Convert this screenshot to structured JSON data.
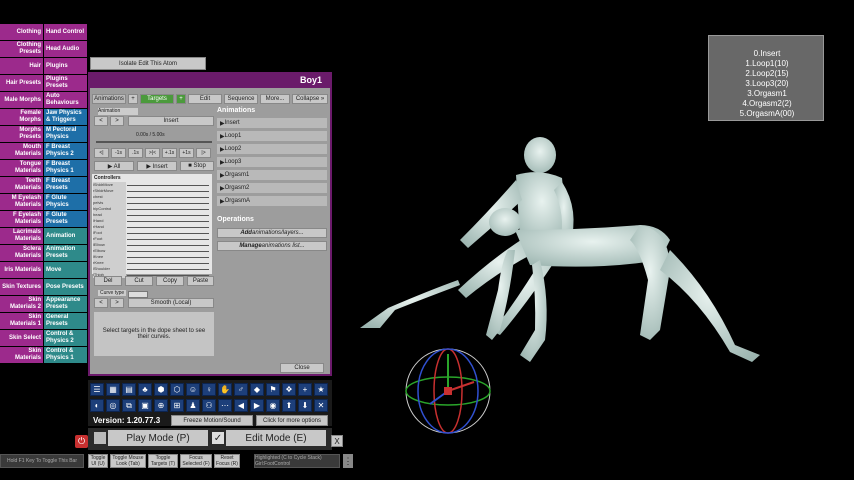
{
  "tabs": {
    "left": [
      "Clothing",
      "Clothing Presets",
      "Hair",
      "Hair Presets",
      "Male Morphs",
      "Female Morphs",
      "Morphs Presets",
      "Mouth Materials",
      "Tongue Materials",
      "Teeth Materials",
      "M Eyelash Materials",
      "F Eyelash Materials",
      "Lacrimals Materials",
      "Sclera Materials",
      "Iris Materials",
      "Skin Textures",
      "Skin Materials 2",
      "Skin Materials 1",
      "Skin Select",
      "Skin Materials"
    ],
    "right": [
      "Hand Control",
      "Head Audio",
      "Plugins",
      "Plugins Presets",
      "Auto Behaviours",
      "Jaw Physics & Triggers",
      "M Pectoral Physics",
      "F Breast Physics 2",
      "F Breast Physics 1",
      "F Breast Presets",
      "F Glute Physics",
      "F Glute Presets",
      "Animation",
      "Animation Presets",
      "Move",
      "Pose Presets",
      "Appearance Presets",
      "General Presets",
      "Control & Physics 2",
      "Control & Physics 1"
    ]
  },
  "isolate_button": "Isolate Edit This Atom",
  "panel": {
    "title": "Boy1",
    "top_tabs": [
      "Animations",
      "+",
      "Targets",
      "+",
      "Edit",
      "Sequence",
      "More...",
      "Collapse »"
    ],
    "animation_label": "Animation",
    "nav_prev": "<",
    "nav_next": ">",
    "insert": "Insert",
    "time_display": "0.00s / 5.00s",
    "transport": [
      "<|",
      "-1s",
      ".1s",
      ">|<",
      "+.1s",
      "+1s",
      "|>"
    ],
    "play_all": "▶ All",
    "play_insert": "▶ Insert",
    "stop": "■ Stop",
    "controllers_label": "Controllers",
    "controllers": [
      "lShldrMove",
      "rShldrMove",
      "chest",
      "pelvis",
      "hipControl",
      "head",
      "lHand",
      "rHand",
      "lFoot",
      "rFoot",
      "lElbow",
      "rElbow",
      "lKnee",
      "rKnee",
      "lShoulder",
      "lThigh"
    ],
    "edit_buttons": [
      "Del",
      "Cut",
      "Copy",
      "Paste"
    ],
    "curve_type_label": "Curve type",
    "curve_value": "Smooth (Local)",
    "curve_hint": "Select targets in the dope sheet to see their curves.",
    "animations_header": "Animations",
    "animations": [
      "Insert",
      "Loop1",
      "Loop2",
      "Loop3",
      "Orgasm1",
      "Orgasm2",
      "OrgasmA"
    ],
    "operations_header": "Operations",
    "add_op_bold": "Add",
    "add_op_rest": " animations/layers...",
    "manage_op_bold": "Manage",
    "manage_op_rest": " animations list...",
    "close": "Close"
  },
  "toolbar": {
    "version": "Version: 1.20.77.3",
    "freeze": "Freeze Motion/Sound",
    "more_options": "Click for more options"
  },
  "modes": {
    "play": "Play Mode (P)",
    "edit": "Edit Mode (E)",
    "close_x": "X"
  },
  "bottom_buttons": [
    "Hold F1 Key To Toggle This Bar",
    "Toggle UI (U)",
    "Toggle Mouse Look (Tab)",
    "Toggle Targets (T)",
    "Focus Selected (F)",
    "Reset Focus (R)",
    "Highlighted (C to Cycle Stack) Girl:FootControl"
  ],
  "sequence_box": [
    "0.Insert",
    "1.Loop1(10)",
    "2.Loop2(15)",
    "3.Loop3(20)",
    "3.Orgasm1",
    "4.Orgasm2(2)",
    "5.OrgasmA(00)"
  ],
  "colors": {
    "accent_magenta": "#9c2a8c",
    "accent_blue": "#1e6fa8",
    "accent_teal": "#2e8a8a",
    "panel_border": "#6b1a6b",
    "grid_green": "#4b9a3c"
  }
}
